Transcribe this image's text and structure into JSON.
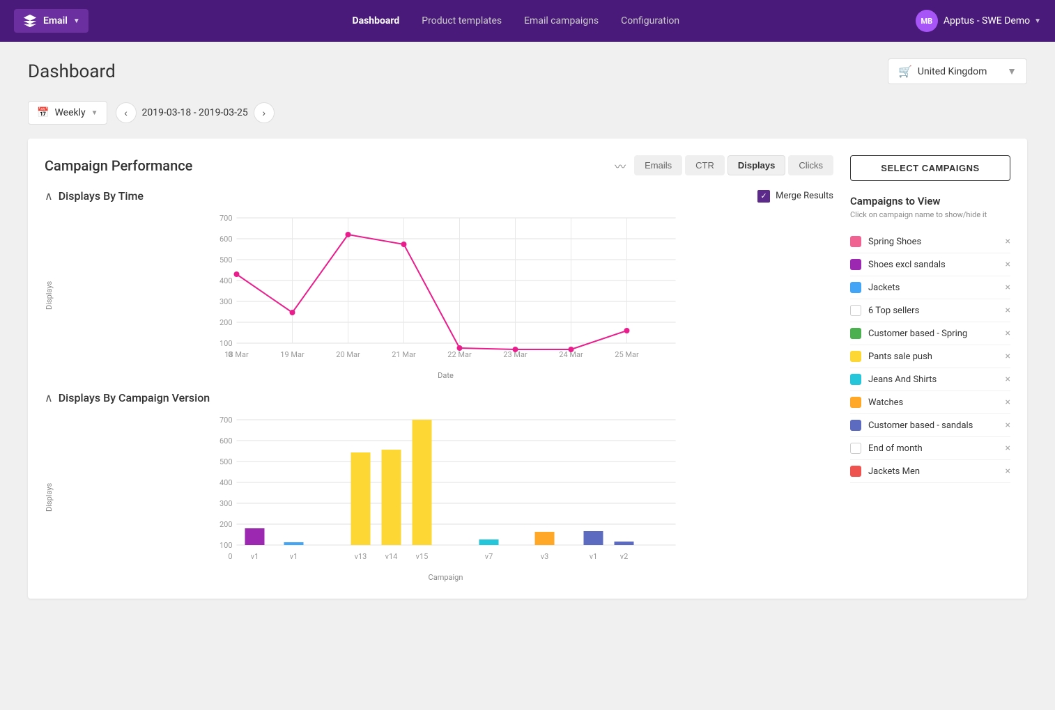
{
  "navbar": {
    "logo_label": "Email",
    "logo_initials": "⚡",
    "links": [
      {
        "label": "Dashboard",
        "active": true
      },
      {
        "label": "Product templates",
        "active": false
      },
      {
        "label": "Email campaigns",
        "active": false
      },
      {
        "label": "Configuration",
        "active": false
      }
    ],
    "user_initials": "MB",
    "user_name": "Apptus - SWE Demo"
  },
  "page": {
    "title": "Dashboard",
    "country": "United Kingdom",
    "country_icon": "🛒"
  },
  "date_filter": {
    "period": "Weekly",
    "date_range": "2019-03-18 - 2019-03-25"
  },
  "chart": {
    "title": "Campaign Performance",
    "tabs": [
      {
        "label": "Emails",
        "active": false
      },
      {
        "label": "CTR",
        "active": false
      },
      {
        "label": "Displays",
        "active": true
      },
      {
        "label": "Clicks",
        "active": false
      }
    ],
    "sections": [
      {
        "title": "Displays By Time",
        "merge_label": "Merge Results",
        "y_label": "Displays",
        "x_label": "Date"
      },
      {
        "title": "Displays By Campaign Version",
        "y_label": "Displays",
        "x_label": "Campaign"
      }
    ]
  },
  "campaigns": {
    "button_label": "SELECT CAMPAIGNS",
    "section_title": "Campaigns to View",
    "section_subtitle": "Click on campaign name to show/hide it",
    "items": [
      {
        "name": "Spring Shoes",
        "color": "#f06292",
        "empty": false
      },
      {
        "name": "Shoes excl sandals",
        "color": "#9c27b0",
        "empty": false
      },
      {
        "name": "Jackets",
        "color": "#42a5f5",
        "empty": false
      },
      {
        "name": "6 Top sellers",
        "color": "",
        "empty": true
      },
      {
        "name": "Customer based - Spring",
        "color": "#4caf50",
        "empty": false
      },
      {
        "name": "Pants sale push",
        "color": "#fdd835",
        "empty": false
      },
      {
        "name": "Jeans And Shirts",
        "color": "#26c6da",
        "empty": false
      },
      {
        "name": "Watches",
        "color": "#ffa726",
        "empty": false
      },
      {
        "name": "Customer based - sandals",
        "color": "#5c6bc0",
        "empty": false
      },
      {
        "name": "End of month",
        "color": "",
        "empty": true
      },
      {
        "name": "Jackets Men",
        "color": "#ef5350",
        "empty": false
      }
    ]
  }
}
